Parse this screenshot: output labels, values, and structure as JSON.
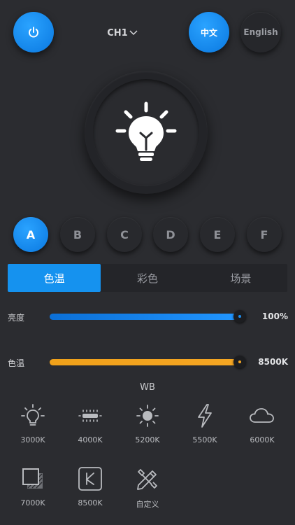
{
  "header": {
    "power_icon": "power-icon",
    "channel": "CH1",
    "channel_icon": "chevron-down-icon",
    "lang_zh": "中文",
    "lang_en": "English"
  },
  "bulb": {
    "icon": "lightbulb-icon"
  },
  "presets": [
    "A",
    "B",
    "C",
    "D",
    "E",
    "F"
  ],
  "active_preset": "A",
  "tabs": [
    {
      "label": "色温",
      "active": true
    },
    {
      "label": "彩色",
      "active": false
    },
    {
      "label": "场景",
      "active": false
    }
  ],
  "sliders": {
    "brightness": {
      "label": "亮度",
      "value": "100%",
      "level": 1.0,
      "color": "#1e8ff0"
    },
    "cct": {
      "label": "色温",
      "value": "8500K",
      "level": 1.0,
      "color": "#f5a623"
    }
  },
  "wb": {
    "title": "WB",
    "items": [
      {
        "label": "3000K",
        "icon": "bulb-outline-icon"
      },
      {
        "label": "4000K",
        "icon": "fluorescent-icon"
      },
      {
        "label": "5200K",
        "icon": "sun-icon"
      },
      {
        "label": "5500K",
        "icon": "flash-icon"
      },
      {
        "label": "6000K",
        "icon": "cloud-icon"
      },
      {
        "label": "7000K",
        "icon": "shade-icon"
      },
      {
        "label": "8500K",
        "icon": "k-icon"
      },
      {
        "label": "自定义",
        "icon": "custom-tools-icon"
      }
    ]
  }
}
